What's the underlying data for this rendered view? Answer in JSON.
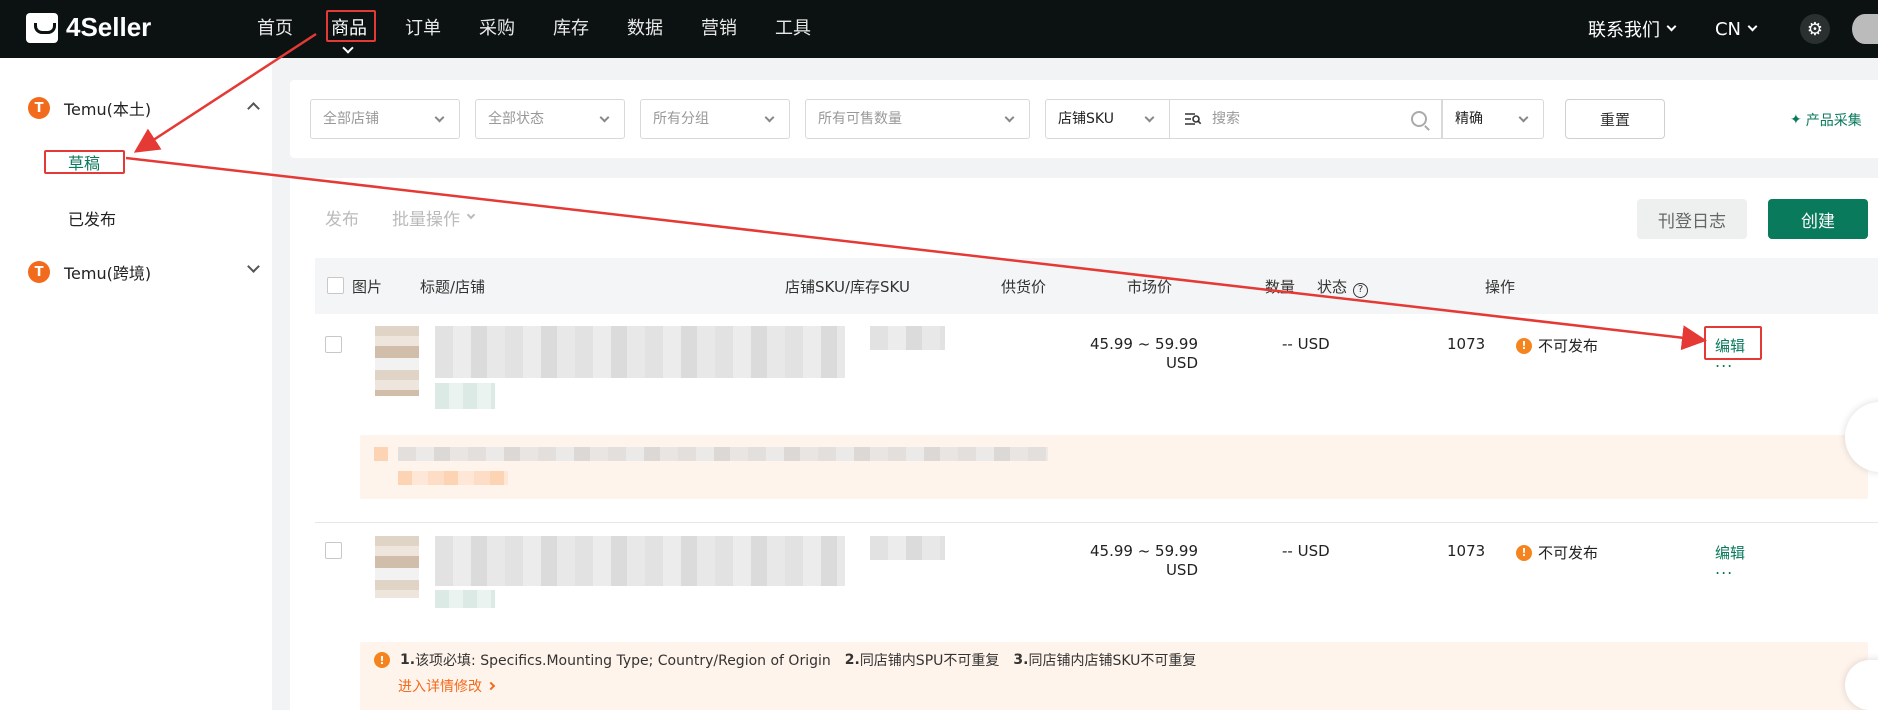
{
  "brand": {
    "name": "4Seller"
  },
  "nav": {
    "items": [
      "首页",
      "商品",
      "订单",
      "采购",
      "库存",
      "数据",
      "营销",
      "工具"
    ],
    "active_index": 1,
    "contact": "联系我们",
    "language": "CN"
  },
  "sidebar": {
    "groups": [
      {
        "label": "Temu(本土)",
        "expanded": true,
        "items": [
          "草稿",
          "已发布"
        ],
        "active_item": "草稿"
      },
      {
        "label": "Temu(跨境)",
        "expanded": false
      }
    ],
    "badge_letter": "T"
  },
  "filters": {
    "store": "全部店铺",
    "status": "全部状态",
    "group": "所有分组",
    "quantity": "所有可售数量",
    "sku_type": "店铺SKU",
    "search_placeholder": "搜索",
    "match": "精确",
    "reset": "重置",
    "collect": "产品采集"
  },
  "toolbar": {
    "publish": "发布",
    "batch": "批量操作",
    "log": "刊登日志",
    "create": "创建"
  },
  "table": {
    "headers": {
      "image": "图片",
      "title": "标题/店铺",
      "sku": "店铺SKU/库存SKU",
      "supply_price": "供货价",
      "market_price": "市场价",
      "quantity": "数量",
      "status": "状态",
      "actions": "操作"
    },
    "rows": [
      {
        "supply_price_range": "45.99 ~ 59.99",
        "supply_price_currency": "USD",
        "market_price": "-- USD",
        "quantity": "1073",
        "status": "不可发布",
        "edit": "编辑",
        "more": "..."
      },
      {
        "supply_price_range": "45.99 ~ 59.99",
        "supply_price_currency": "USD",
        "market_price": "-- USD",
        "quantity": "1073",
        "status": "不可发布",
        "edit": "编辑",
        "more": "...",
        "warning": {
          "p1_num": "1.",
          "p1": "该项必填: Specifics.Mounting Type; Country/Region of Origin",
          "p2_num": "2.",
          "p2": "同店铺内SPU不可重复",
          "p3_num": "3.",
          "p3": "同店铺内店铺SKU不可重复",
          "link": "进入详情修改"
        }
      }
    ]
  },
  "colors": {
    "accent": "#0a7a5c",
    "warning": "#f26b1d",
    "annotation": "#e53935",
    "topbar": "#0b1211"
  }
}
